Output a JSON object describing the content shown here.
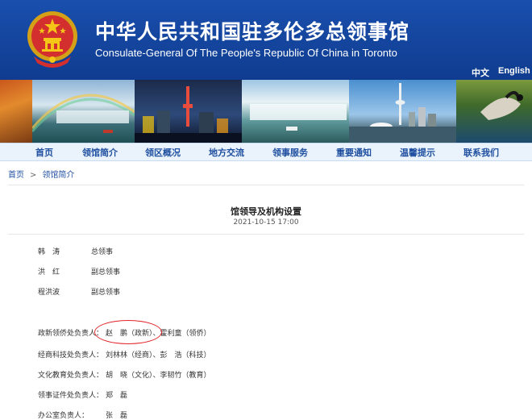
{
  "header": {
    "title_cn": "中华人民共和国驻多伦多总领事馆",
    "title_en": "Consulate-General Of The People's Republic Of China in Toronto",
    "lang_cn": "中文",
    "lang_en": "English"
  },
  "photos": [
    "autumn-maple-leaves",
    "niagara-falls-rainbow",
    "toronto-skyline-night",
    "niagara-falls-boat",
    "toronto-cn-tower-skyline",
    "canada-goose"
  ],
  "nav": [
    "首页",
    "领馆简介",
    "领区概况",
    "地方交流",
    "领事服务",
    "重要通知",
    "温馨提示",
    "联系我们"
  ],
  "breadcrumb": {
    "home": "首页",
    "separator": ">",
    "current": "领馆简介"
  },
  "article": {
    "title": "馆领导及机构设置",
    "date": "2021-10-15 17:00",
    "leaders": [
      {
        "name": "韩　涛",
        "role": "总领事"
      },
      {
        "name": "洪　红",
        "role": "副总领事"
      },
      {
        "name": "程洪波",
        "role": "副总领事"
      }
    ],
    "departments": [
      {
        "label": "政新领侨处负责人：",
        "people": "赵　鹏（政新）、霍利童（领侨）"
      },
      {
        "label": "经商科技处负责人：",
        "people": "刘林林（经商）、彭　浩（科技）"
      },
      {
        "label": "文化教育处负责人：",
        "people": "胡　晓（文化）、李韧竹（教育）"
      },
      {
        "label": "领事证件处负责人：",
        "people": "郑　磊"
      },
      {
        "label": "办公室负责人：",
        "people": "张　磊"
      }
    ]
  },
  "colors": {
    "header_blue": "#1a4fae",
    "nav_text": "#1f4fa0",
    "nav_bg": "#eaf3fb",
    "annotation_red": "#e0262b"
  }
}
